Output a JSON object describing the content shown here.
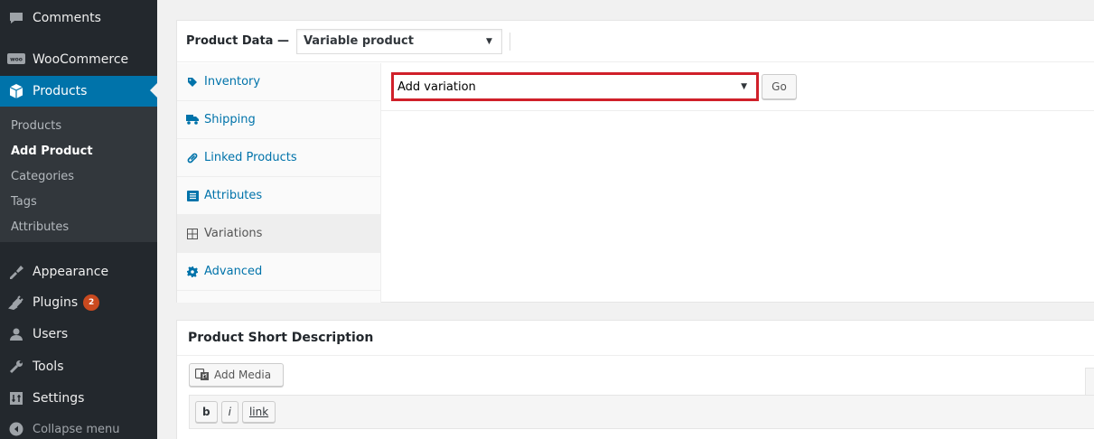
{
  "sidebar": {
    "items": [
      {
        "label": "Comments",
        "icon": "comment-icon"
      },
      {
        "label": "WooCommerce",
        "icon": "woocommerce-icon"
      },
      {
        "label": "Products",
        "icon": "products-icon"
      },
      {
        "label": "Appearance",
        "icon": "appearance-icon"
      },
      {
        "label": "Plugins",
        "icon": "plugins-icon",
        "badge": "2"
      },
      {
        "label": "Users",
        "icon": "users-icon"
      },
      {
        "label": "Tools",
        "icon": "tools-icon"
      },
      {
        "label": "Settings",
        "icon": "settings-icon"
      }
    ],
    "submenu": [
      "Products",
      "Add Product",
      "Categories",
      "Tags",
      "Attributes"
    ],
    "collapse_label": "Collapse menu",
    "accent_color": "#0073aa"
  },
  "product_data": {
    "title": "Product Data —",
    "type_value": "Variable product",
    "tabs": [
      "Inventory",
      "Shipping",
      "Linked Products",
      "Attributes",
      "Variations",
      "Advanced"
    ],
    "variation_select": "Add variation",
    "go_label": "Go",
    "highlight_color": "#d0202a"
  },
  "short_description": {
    "title": "Product Short Description",
    "add_media_label": "Add Media",
    "quicktags": [
      "b",
      "i",
      "link"
    ]
  }
}
